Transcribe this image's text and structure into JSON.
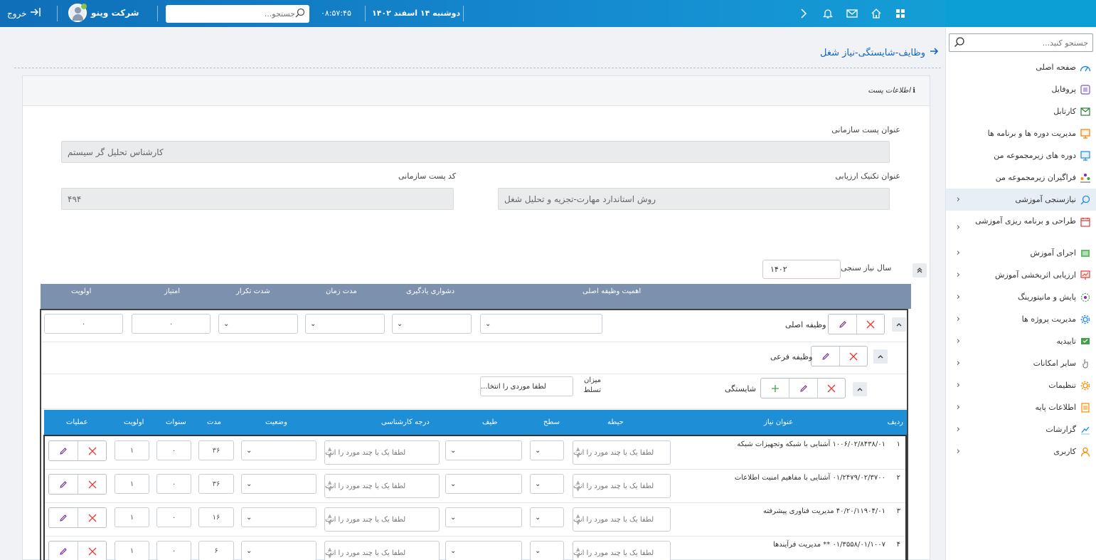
{
  "topbar": {
    "logout_label": "خروج",
    "company_name": "شرکت وینو",
    "search_placeholder": "جستجو...",
    "time": "۰۸:۵۷:۴۵",
    "date": "دوشنبه ۱۴ اسفند ۱۴۰۲"
  },
  "sidebar": {
    "search_placeholder": "جستجو کنید...",
    "items": [
      {
        "label": "صفحه اصلی",
        "icon": "dashboard-icon"
      },
      {
        "label": "پروفایل",
        "icon": "profile-icon"
      },
      {
        "label": "کارتابل",
        "icon": "mail-icon"
      },
      {
        "label": "مدیریت دوره ها و برنامه ها",
        "icon": "presentation-icon"
      },
      {
        "label": "دوره های زیرمجموعه من",
        "icon": "presentation-icon"
      },
      {
        "label": "فراگیران زیرمجموعه من",
        "icon": "group-icon"
      },
      {
        "label": "نیازسنجی آموزشی",
        "icon": "search-icon"
      },
      {
        "label": "طراحی و برنامه ریزی آموزشی",
        "icon": "calendar-icon"
      },
      {
        "label": "اجرای آموزش",
        "icon": "list-icon"
      },
      {
        "label": "ارزیابی اثربخشی آموزش",
        "icon": "chart-icon"
      },
      {
        "label": "پایش و مانیتورینگ",
        "icon": "monitor-icon"
      },
      {
        "label": "مدیریت پروژه ها",
        "icon": "gear-icon"
      },
      {
        "label": "تاییدیه",
        "icon": "approve-icon"
      },
      {
        "label": "سایر امکانات",
        "icon": "hand-icon"
      },
      {
        "label": "تنظیمات",
        "icon": "settings-icon"
      },
      {
        "label": "اطلاعات پایه",
        "icon": "document-icon"
      },
      {
        "label": "گزارشات",
        "icon": "report-icon"
      },
      {
        "label": "کاربری",
        "icon": "user-icon"
      }
    ]
  },
  "page": {
    "title": "وظایف-شایستگی-نیاز شغل",
    "card_title": "اطلاعات پست",
    "post_title_label": "عنوان پست سازمانی",
    "post_title_value": "کارشناس تحلیل گر سیستم",
    "technique_label": "عنوان تکنیک ارزیابی",
    "technique_value": "روش استاندارد مهارت-تجزیه و تحلیل شغل",
    "post_code_label": "کد پست سازمانی",
    "post_code_value": "۴۹۴",
    "year_label": "سال نیاز سنجی",
    "year_value": "۱۴۰۲"
  },
  "task_header": {
    "importance": "اهمیت وظیفه اصلی",
    "difficulty": "دشواری یادگیری",
    "duration": "مدت زمان",
    "frequency": "شدت تکرار",
    "score": "امتیاز",
    "priority": "اولویت"
  },
  "task_rows": {
    "main_task": "وظیفه اصلی",
    "sub_task": "وظیفه فرعی",
    "competency": "شایستگی",
    "mastery_label": "میزان تسلط",
    "mastery_placeholder": "لطفا موردی را انتخا...",
    "score_value": "۰",
    "priority_value": "۰"
  },
  "grid": {
    "headers": {
      "row": "ردیف",
      "need_title": "عنوان نیاز",
      "domain": "حیطه",
      "level": "سطح",
      "spectrum": "طیف",
      "expertise": "درجه کارشناسی",
      "status": "وضعیت",
      "duration": "مدت",
      "years": "سنوات",
      "priority": "اولویت",
      "actions": "عملیات"
    },
    "multi_placeholder": "لطفا یک یا چند مورد را انت",
    "rows": [
      {
        "no": "۱",
        "title": "۱۰۰۶/۰۲/۸۴۳۸/۰۱ آشنایی با شبکه وتجهیزات شبکه",
        "duration": "۳۶",
        "years": "۰",
        "priority": "۱"
      },
      {
        "no": "۲",
        "title": "۰۱/۲۴۷۹/۰۲/۳۷۰۰ آشنایی با مفاهیم امنیت اطلاعات",
        "duration": "۳۶",
        "years": "۰",
        "priority": "۱"
      },
      {
        "no": "۳",
        "title": "۴۰/۲۰/۱۱۹۰۴/۰۱ مدیریت فناوری پیشرفته",
        "duration": "۱۶",
        "years": "۰",
        "priority": "۱"
      },
      {
        "no": "۴",
        "title": "۰۱/۳۵۵۸/۰۱/۱۰۰۷ ** مدیریت فرآیندها",
        "duration": "۶",
        "years": "۰",
        "priority": "۱"
      }
    ]
  }
}
